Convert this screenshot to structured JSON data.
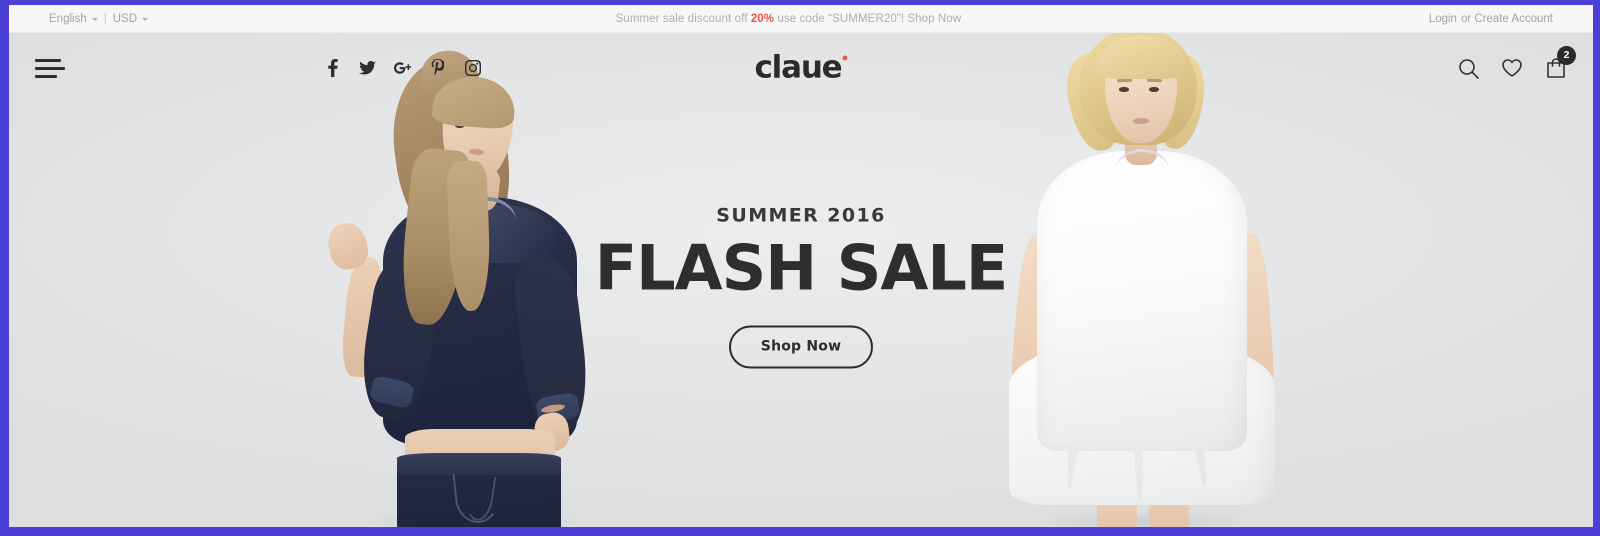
{
  "topbar": {
    "language": "English",
    "currency": "USD",
    "divider": "|",
    "promo_prefix": "Summer sale discount off",
    "promo_percent": "20%",
    "promo_middle": "use code “SUMMER20”!",
    "promo_cta": "Shop Now",
    "login_label": "Login",
    "account_label": "or Create Account"
  },
  "header": {
    "menu_icon": "hamburger-icon",
    "brand_name": "claue",
    "socials": [
      {
        "name": "facebook-icon",
        "label": "Facebook"
      },
      {
        "name": "twitter-icon",
        "label": "Twitter"
      },
      {
        "name": "google-plus-icon",
        "label": "Google Plus"
      },
      {
        "name": "pinterest-icon",
        "label": "Pinterest"
      },
      {
        "name": "instagram-icon",
        "label": "Instagram"
      }
    ],
    "actions": {
      "search_label": "Search",
      "wishlist_label": "Wishlist",
      "cart_label": "Cart",
      "cart_count": "2"
    }
  },
  "hero": {
    "eyebrow": "SUMMER 2016",
    "title": "FLASH SALE",
    "cta": "Shop Now"
  },
  "colors": {
    "frame_purple": "#4b3fd6",
    "topbar_bg": "#f7f7f7",
    "hero_bg": "#e7e8ea",
    "accent_red": "#e8554d",
    "text_dark": "#2c2c2c",
    "muted_text": "#aeaeae",
    "badge_bg": "#2a2a2a"
  }
}
